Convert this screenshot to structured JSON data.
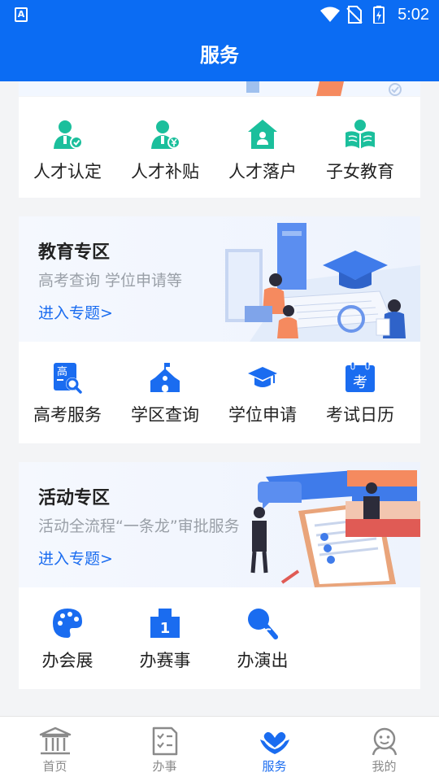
{
  "statusbar": {
    "time": "5:02"
  },
  "header": {
    "title": "服务"
  },
  "talent": {
    "items": [
      {
        "label": "人才认定",
        "icon": "talent-verify-icon"
      },
      {
        "label": "人才补贴",
        "icon": "talent-subsidy-icon"
      },
      {
        "label": "人才落户",
        "icon": "house-icon"
      },
      {
        "label": "子女教育",
        "icon": "child-reading-icon"
      }
    ]
  },
  "education": {
    "title": "教育专区",
    "subtitle": "高考查询 学位申请等",
    "link": "进入专题>",
    "items": [
      {
        "label": "高考服务",
        "icon": "exam-search-icon"
      },
      {
        "label": "学区查询",
        "icon": "school-icon"
      },
      {
        "label": "学位申请",
        "icon": "graduation-cap-icon"
      },
      {
        "label": "考试日历",
        "icon": "calendar-icon",
        "glyph": "考"
      }
    ]
  },
  "activity": {
    "title": "活动专区",
    "subtitle": "活动全流程“一条龙”审批服务",
    "link": "进入专题>",
    "items": [
      {
        "label": "办会展",
        "icon": "palette-icon"
      },
      {
        "label": "办赛事",
        "icon": "podium-icon",
        "glyph": "1"
      },
      {
        "label": "办演出",
        "icon": "microphone-icon"
      }
    ]
  },
  "tabbar": {
    "tabs": [
      {
        "label": "首页",
        "icon": "home-building-icon",
        "active": false
      },
      {
        "label": "办事",
        "icon": "checklist-icon",
        "active": false
      },
      {
        "label": "服务",
        "icon": "heart-hand-icon",
        "active": true
      },
      {
        "label": "我的",
        "icon": "user-icon",
        "active": false
      }
    ]
  },
  "colors": {
    "primary": "#0b6cf3",
    "teal": "#1bbf9c",
    "blue_icon": "#1a6cf0"
  }
}
